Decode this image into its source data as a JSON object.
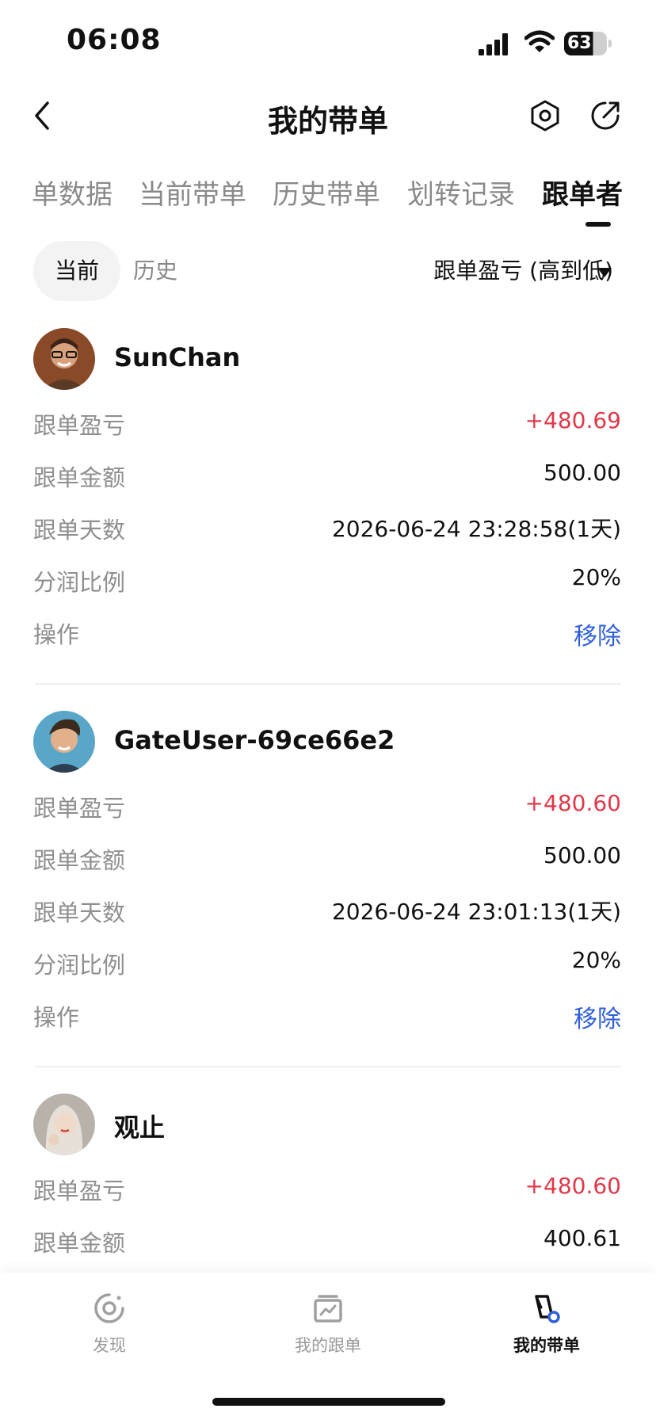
{
  "status_bar": {
    "time": "06:08",
    "battery": "63"
  },
  "nav": {
    "title": "我的带单"
  },
  "tabs": [
    {
      "label": "单数据",
      "active": false
    },
    {
      "label": "当前带单",
      "active": false
    },
    {
      "label": "历史带单",
      "active": false
    },
    {
      "label": "划转记录",
      "active": false
    },
    {
      "label": "跟单者",
      "active": true
    }
  ],
  "subfilter": {
    "current": "当前",
    "history": "历史",
    "sort": "跟单盈亏 (高到低)"
  },
  "labels": {
    "pnl": "跟单盈亏",
    "amount": "跟单金额",
    "days": "跟单天数",
    "share": "分润比例",
    "action": "操作"
  },
  "followers": [
    {
      "name": "SunChan",
      "pnl": "+480.69",
      "amount": "500.00",
      "days": "2026-06-24 23:28:58(1天)",
      "share": "20%",
      "action": "移除"
    },
    {
      "name": "GateUser-69ce66e2",
      "pnl": "+480.60",
      "amount": "500.00",
      "days": "2026-06-24 23:01:13(1天)",
      "share": "20%",
      "action": "移除"
    },
    {
      "name": "观止",
      "pnl": "+480.60",
      "amount": "400.61"
    }
  ],
  "bottom_nav": [
    {
      "label": "发现",
      "icon": "discover-icon",
      "active": false
    },
    {
      "label": "我的跟单",
      "icon": "chart-icon",
      "active": false
    },
    {
      "label": "我的带单",
      "icon": "lead-trade-icon",
      "active": true
    }
  ],
  "colors": {
    "profit": "#e0394a",
    "link": "#2f5fd9",
    "muted": "#8f8f8f"
  }
}
